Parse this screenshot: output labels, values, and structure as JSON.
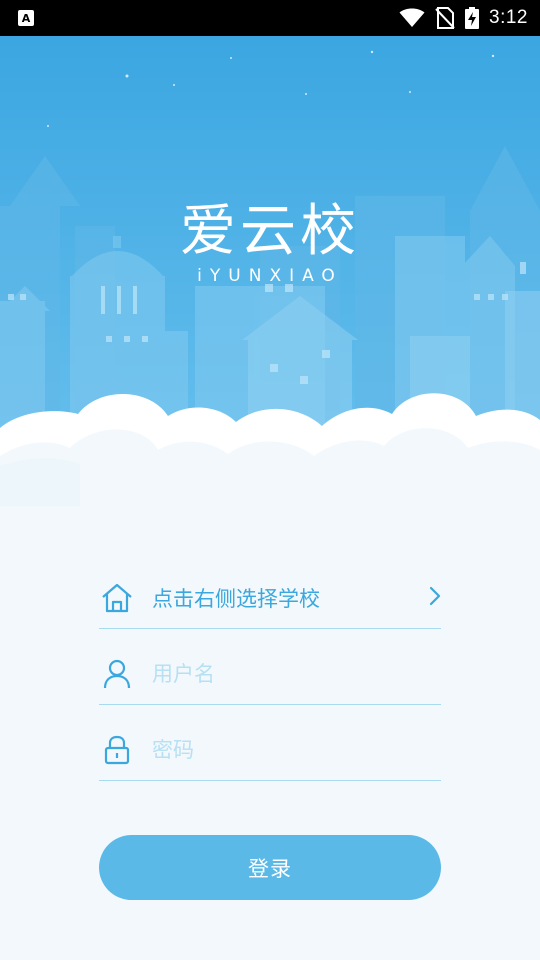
{
  "status_bar": {
    "notification_icon": "a-icon",
    "notification_letter": "A",
    "icons": [
      "wifi-icon",
      "no-sim-icon",
      "battery-charging-icon"
    ],
    "time": "3:12"
  },
  "header": {
    "title": "爱云校",
    "subtitle": "iYUNXIAO"
  },
  "form": {
    "school": {
      "icon": "home-icon",
      "text": "点击右侧选择学校",
      "action_icon": "chevron-right-icon"
    },
    "username": {
      "icon": "user-icon",
      "placeholder": "用户名"
    },
    "password": {
      "icon": "lock-icon",
      "placeholder": "密码"
    }
  },
  "login_button": {
    "label": "登录"
  },
  "colors": {
    "accent": "#5ab9e6",
    "icon": "#3aa7de",
    "placeholder": "#b7e0f3",
    "sky_top": "#3ba6e1",
    "sky_bottom": "#6bc2ee",
    "background": "#f2f8fc"
  }
}
